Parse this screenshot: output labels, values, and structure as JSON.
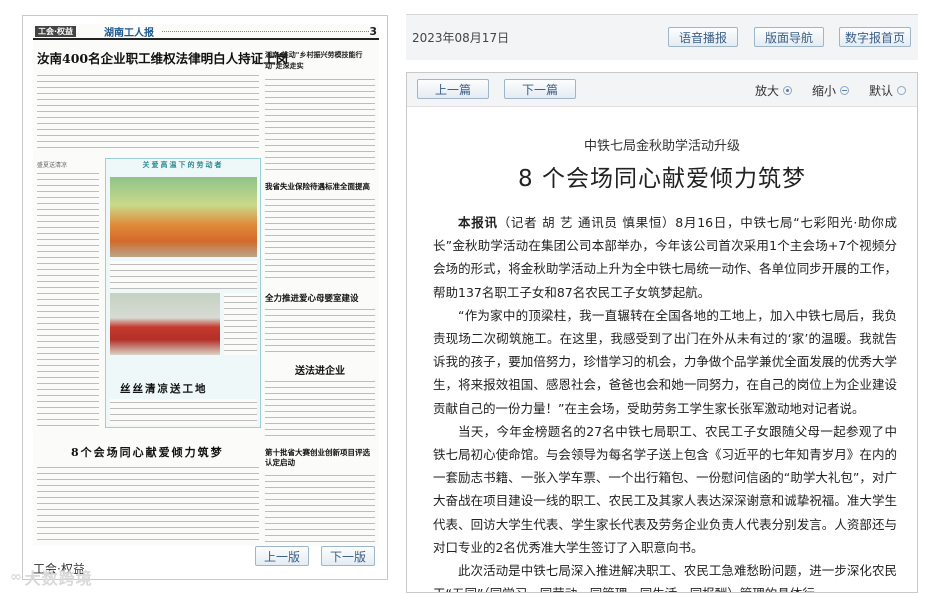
{
  "left_panel": {
    "mini_page": {
      "section_tag": "工会·权益",
      "masthead": "湖南工人报",
      "page_no": "3",
      "main_headline": "汝南400名企业职工维权法律明白人持证上岗",
      "right_headline": "湖南:推动\"乡村振兴劳模技能行动\"走深走实",
      "feature_title": "关爱高温下的劳动者",
      "feature_headline": "丝丝清凉送工地",
      "headline_2": "我省失业保险待遇标准全面提高",
      "headline_3": "全力推进爱心母婴室建设",
      "headline_4": "送法进企业",
      "headline_5": "8个会场同心献爱倾力筑梦",
      "headline_6": "第十批省大赛创业创新项目评选认定启动",
      "left_small_headline": "盛夏送清凉"
    },
    "section_name": "工会·权益",
    "prev_label": "上一版",
    "next_label": "下一版",
    "watermark": "大数跨境"
  },
  "top_bar": {
    "date": "2023年08月17日",
    "buttons": [
      "语音播报",
      "版面导航",
      "数字报首页"
    ]
  },
  "article_bar": {
    "prev_label": "上一篇",
    "next_label": "下一篇",
    "zoom_in": "放大",
    "zoom_out": "缩小",
    "default": "默认"
  },
  "article": {
    "kicker": "中铁七局金秋助学活动升级",
    "title": "8 个会场同心献爱倾力筑梦",
    "lead_tag": "本报讯",
    "p1": "（记者 胡 艺 通讯员 慎果恒）8月16日，中铁七局“七彩阳光·助你成长”金秋助学活动在集团公司本部举办，今年该公司首次采用1个主会场+7个视频分会场的形式，将金秋助学活动上升为全中铁七局统一动作、各单位同步开展的工作，帮助137名职工子女和87名农民工子女筑梦起航。",
    "p2": "“作为家中的顶梁柱，我一直辗转在全国各地的工地上，加入中铁七局后，我负责现场二次砌筑施工。在这里，我感受到了出门在外从未有过的‘家’的温暖。我就告诉我的孩子，要加倍努力，珍惜学习的机会，力争做个品学兼优全面发展的优秀大学生，将来报效祖国、感恩社会，爸爸也会和她一同努力，在自己的岗位上为企业建设贡献自己的一份力量！”在主会场，受助劳务工学生家长张军激动地对记者说。",
    "p3": "当天，今年金榜题名的27名中铁七局职工、农民工子女跟随父母一起参观了中铁七局初心使命馆。与会领导为每名学子送上包含《习近平的七年知青岁月》在内的一套励志书籍、一张入学车票、一个出行箱包、一份慰问信函的“助学大礼包”，对广大奋战在项目建设一线的职工、农民工及其家人表达深深谢意和诚挚祝福。准大学生代表、回访大学生代表、学生家长代表及劳务企业负责人代表分别发言。人资部还与对口专业的2名优秀准大学生签订了入职意向书。",
    "p4": "此次活动是中铁七局深入推进解决职工、农民工急难愁盼问题，进一步深化农民工“五同”（同学习、同劳动、同管理、同生活、同报酬）管理的具体行"
  }
}
